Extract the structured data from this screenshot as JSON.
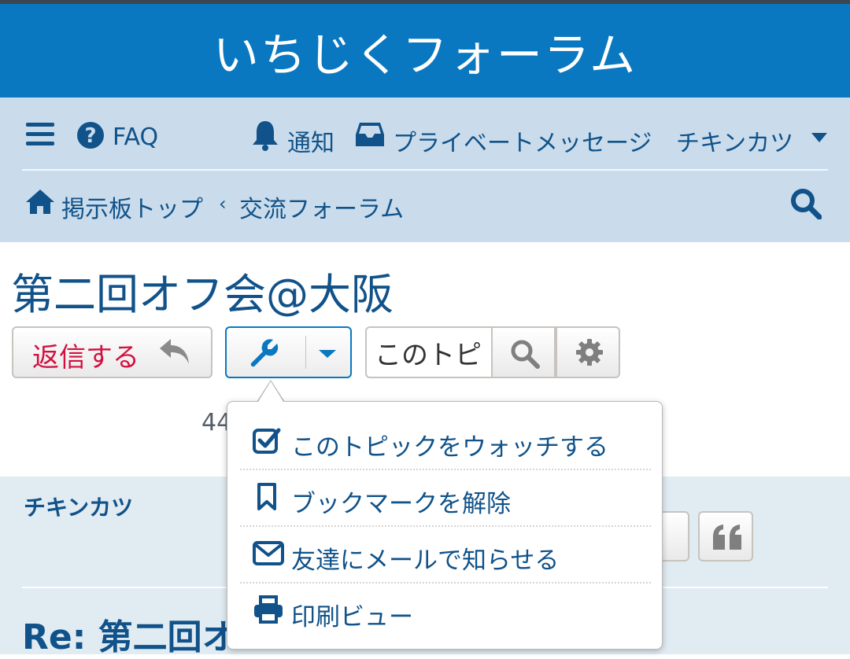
{
  "site": {
    "title": "いちじくフォーラム"
  },
  "nav": {
    "menu_icon": "hamburger-icon",
    "faq_label": "FAQ",
    "notifications_label": "通知",
    "messages_label": "プライベートメッセージ",
    "user_label": "チキンカツ"
  },
  "breadcrumb": {
    "home_label": "掲示板トップ",
    "separator": "‹",
    "forum_label": "交流フォーラム"
  },
  "topic": {
    "title": "第二回オフ会@大阪",
    "reply_label": "返信する",
    "search_value": "このトピ",
    "pagination_text": "44"
  },
  "tools_menu": {
    "items": [
      {
        "label": "このトピックをウォッチする",
        "icon": "check-square-icon"
      },
      {
        "label": "ブックマークを解除",
        "icon": "bookmark-icon"
      },
      {
        "label": "友達にメールで知らせる",
        "icon": "envelope-icon"
      },
      {
        "label": "印刷ビュー",
        "icon": "print-icon"
      }
    ]
  },
  "post": {
    "author": "チキンカツ",
    "title": "Re: 第二回オ"
  },
  "colors": {
    "header_bg": "#0a78c0",
    "nav_bg": "#cadceb",
    "link": "#105289",
    "reply_text": "#d31141",
    "post_bg": "#e1ebf2"
  }
}
